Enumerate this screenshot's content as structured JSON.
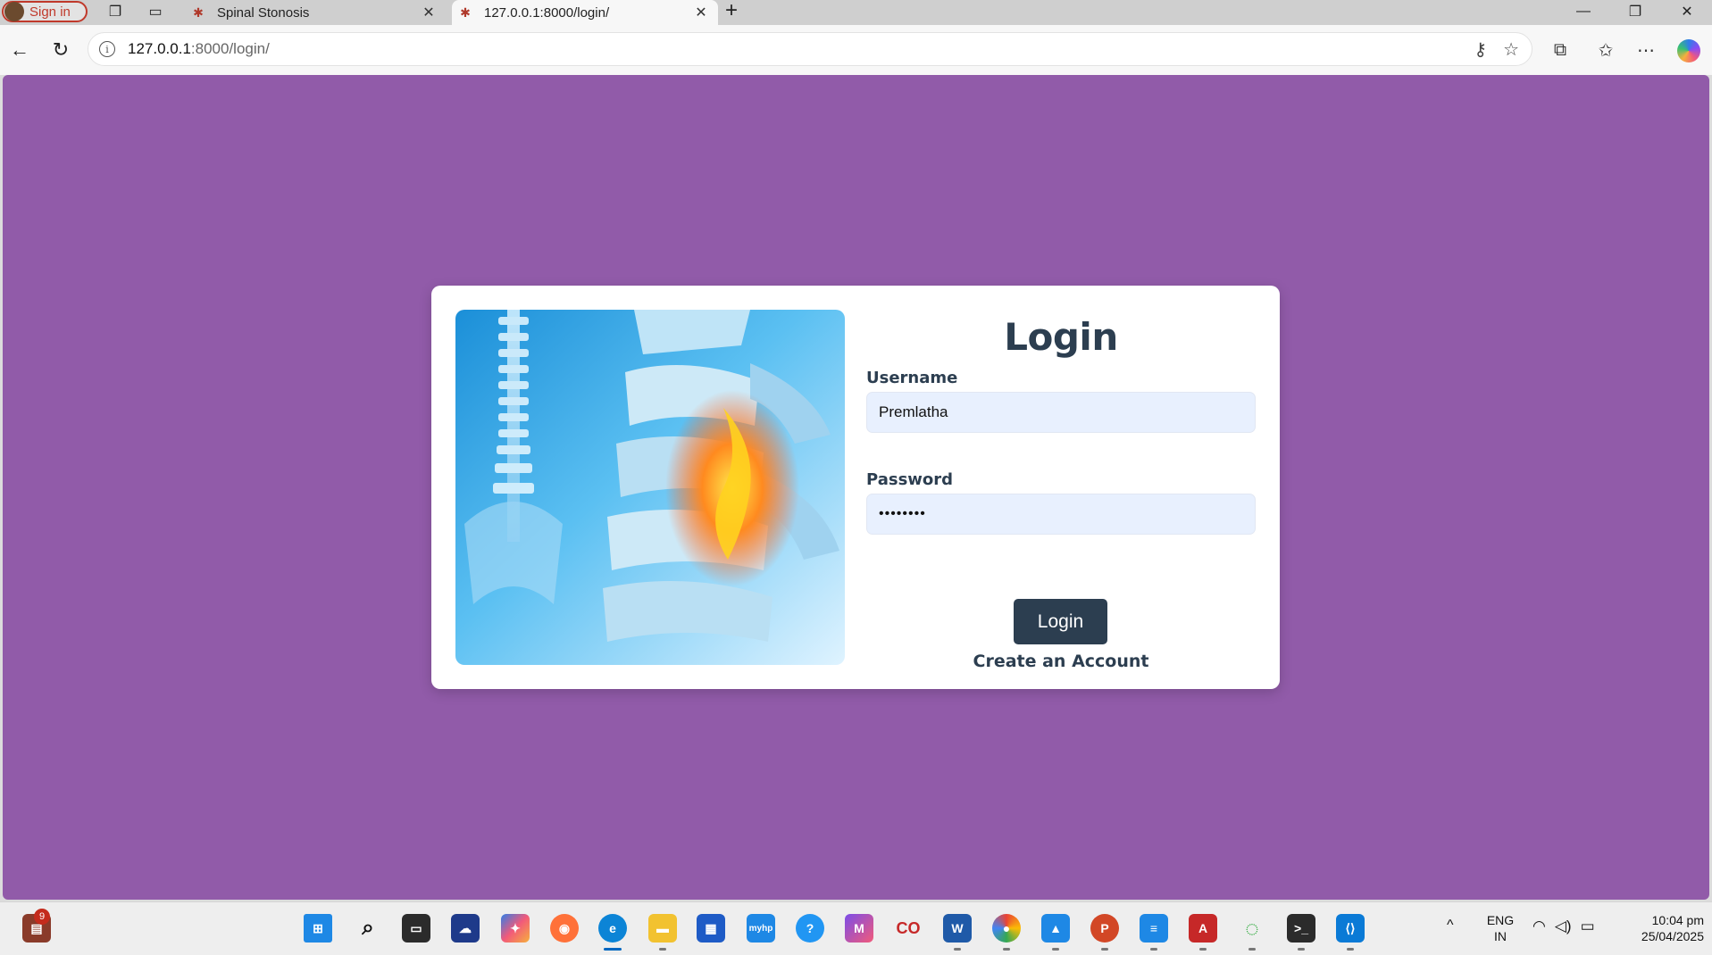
{
  "browser": {
    "profile_label": "Sign in",
    "tabs": [
      {
        "title": "Spinal Stonosis"
      },
      {
        "title": "127.0.0.1:8000/login/"
      }
    ],
    "url_host": "127.0.0.1",
    "url_path": ":8000/login/"
  },
  "page": {
    "background_color": "#915ba9",
    "hero_image": "spine-xray-image",
    "form": {
      "title": "Login",
      "username_label": "Username",
      "username_value": "Premlatha",
      "password_label": "Password",
      "password_value": "••••••••",
      "submit_label": "Login",
      "create_account_label": "Create an Account"
    },
    "accent_color": "#2c3e50"
  },
  "taskbar": {
    "badge_count": "9",
    "language_line1": "ENG",
    "language_line2": "IN",
    "time": "10:04 pm",
    "date": "25/04/2025"
  }
}
